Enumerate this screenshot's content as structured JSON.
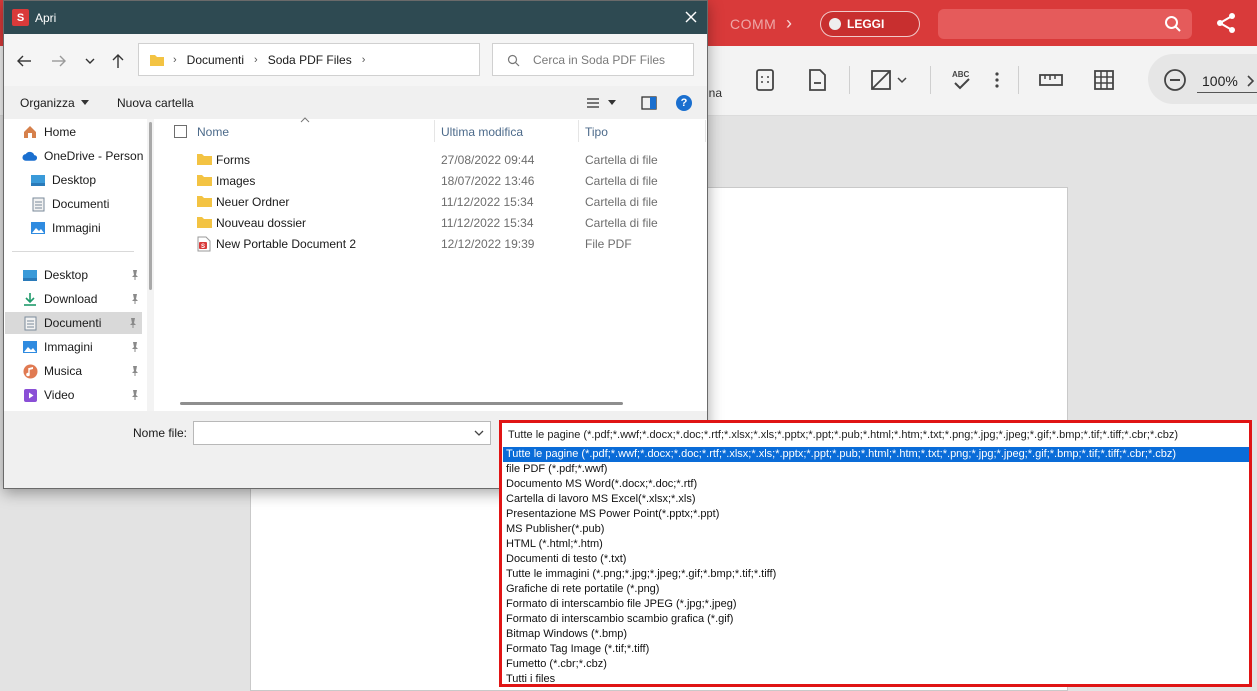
{
  "app": {
    "comm_label": "COMM",
    "read_toggle_label": "LEGGI",
    "partial_label": "ina",
    "zoom_value": "100%"
  },
  "dialog": {
    "title": "Apri",
    "breadcrumb": [
      "Documenti",
      "Soda PDF Files"
    ],
    "search_placeholder": "Cerca in Soda PDF Files",
    "organize_label": "Organizza",
    "new_folder_label": "Nuova cartella",
    "nav_items": [
      {
        "label": "Home",
        "icon": "home-icon"
      },
      {
        "label": "OneDrive - Person",
        "icon": "cloud-icon"
      },
      {
        "label": "Desktop",
        "icon": "desktop-icon"
      },
      {
        "label": "Documenti",
        "icon": "document-icon"
      },
      {
        "label": "Immagini",
        "icon": "image-icon"
      },
      {
        "label": "Desktop",
        "icon": "desktop-icon",
        "pinned": true
      },
      {
        "label": "Download",
        "icon": "download-icon",
        "pinned": true
      },
      {
        "label": "Documenti",
        "icon": "document-icon",
        "pinned": true,
        "selected": true
      },
      {
        "label": "Immagini",
        "icon": "image-icon",
        "pinned": true
      },
      {
        "label": "Musica",
        "icon": "music-icon",
        "pinned": true
      },
      {
        "label": "Video",
        "icon": "video-icon",
        "pinned": true
      }
    ],
    "columns": {
      "name": "Nome",
      "modified": "Ultima modifica",
      "type": "Tipo"
    },
    "files": [
      {
        "name": "Forms",
        "modified": "27/08/2022 09:44",
        "type": "Cartella di file",
        "icon": "folder-icon"
      },
      {
        "name": "Images",
        "modified": "18/07/2022 13:46",
        "type": "Cartella di file",
        "icon": "folder-icon"
      },
      {
        "name": "Neuer Ordner",
        "modified": "11/12/2022 15:34",
        "type": "Cartella di file",
        "icon": "folder-icon"
      },
      {
        "name": "Nouveau dossier",
        "modified": "11/12/2022 15:34",
        "type": "Cartella di file",
        "icon": "folder-icon"
      },
      {
        "name": "New Portable Document 2",
        "modified": "12/12/2022 19:39",
        "type": "File PDF",
        "icon": "pdf-file-icon"
      }
    ],
    "filename_label": "Nome file:",
    "filename_value": ""
  },
  "file_type": {
    "current": "Tutte le pagine (*.pdf;*.wwf;*.docx;*.doc;*.rtf;*.xlsx;*.xls;*.pptx;*.ppt;*.pub;*.html;*.htm;*.txt;*.png;*.jpg;*.jpeg;*.gif;*.bmp;*.tif;*.tiff;*.cbr;*.cbz)",
    "options": [
      "Tutte le pagine (*.pdf;*.wwf;*.docx;*.doc;*.rtf;*.xlsx;*.xls;*.pptx;*.ppt;*.pub;*.html;*.htm;*.txt;*.png;*.jpg;*.jpeg;*.gif;*.bmp;*.tif;*.tiff;*.cbr;*.cbz)",
      "file PDF (*.pdf;*.wwf)",
      "Documento MS Word(*.docx;*.doc;*.rtf)",
      "Cartella di lavoro MS Excel(*.xlsx;*.xls)",
      "Presentazione MS Power Point(*.pptx;*.ppt)",
      "MS Publisher(*.pub)",
      "HTML (*.html;*.htm)",
      "Documenti di testo (*.txt)",
      "Tutte le immagini (*.png;*.jpg;*.jpeg;*.gif;*.bmp;*.tif;*.tiff)",
      "Grafiche di rete portatile (*.png)",
      "Formato di interscambio file JPEG (*.jpg;*.jpeg)",
      "Formato di interscambio scambio grafica (*.gif)",
      "Bitmap Windows (*.bmp)",
      "Formato Tag Image (*.tif;*.tiff)",
      "Fumetto (*.cbr;*.cbz)",
      "Tutti i files"
    ],
    "selected_index": 0
  },
  "colors": {
    "brand_red": "#d93a3a",
    "title_bar": "#2e4a52",
    "selection_blue": "#0a6cd8",
    "highlight_border": "#e01414",
    "folder_yellow": "#f3c343"
  }
}
